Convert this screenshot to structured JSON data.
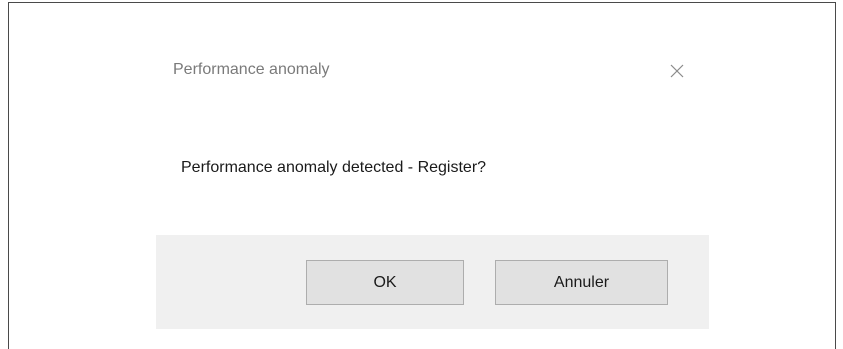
{
  "dialog": {
    "title": "Performance anomaly",
    "message": "Performance anomaly detected - Register?",
    "close_icon": "close-icon",
    "buttons": {
      "ok_label": "OK",
      "cancel_label": "Annuler"
    }
  },
  "colors": {
    "background": "#ffffff",
    "footer": "#f0f0f0",
    "button_bg": "#e1e1e1",
    "button_border": "#adadad",
    "title_text": "#7a7a7a",
    "body_text": "#1a1a1a"
  }
}
